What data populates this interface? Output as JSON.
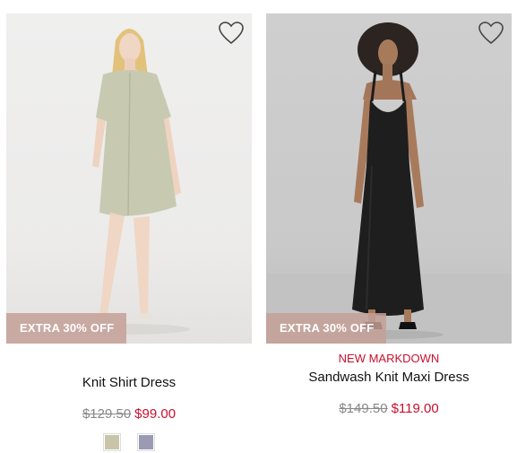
{
  "products": [
    {
      "badge": "EXTRA 30% OFF",
      "markdown": "",
      "name": "Knit Shirt Dress",
      "original_price": "$129.50",
      "sale_price": "$99.00",
      "swatches": [
        {
          "name": "sage",
          "color": "#c9c4a8"
        },
        {
          "name": "lavender-grey",
          "color": "#9a9bb3"
        }
      ]
    },
    {
      "badge": "EXTRA 30% OFF",
      "markdown": "NEW MARKDOWN",
      "name": "Sandwash Knit Maxi Dress",
      "original_price": "$149.50",
      "sale_price": "$119.00",
      "swatches": []
    }
  ],
  "colors": {
    "sale": "#c8102e",
    "badge_bg": "#c4a096"
  },
  "icons": {
    "favorite": "heart-outline-icon"
  }
}
